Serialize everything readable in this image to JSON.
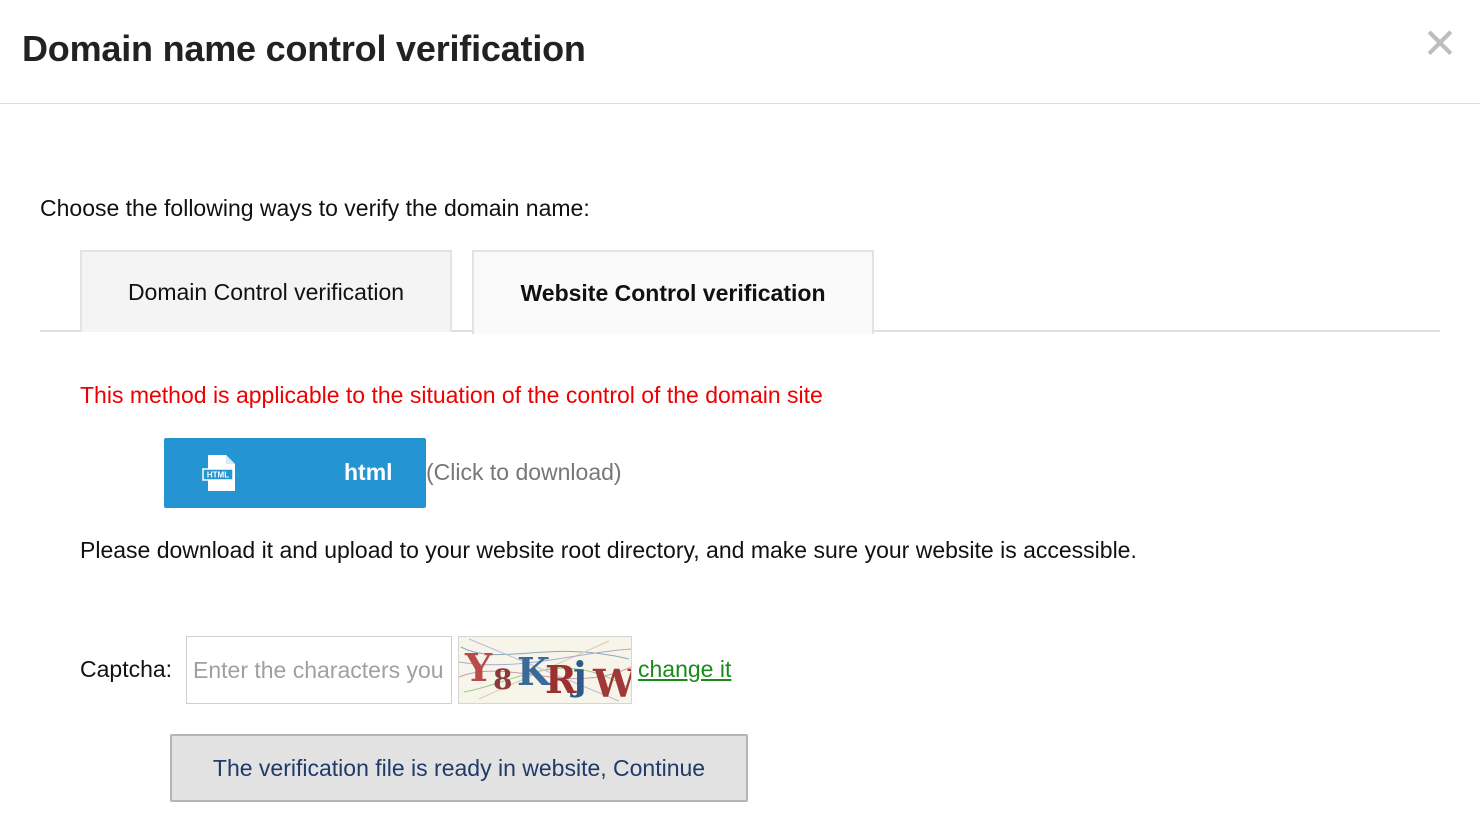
{
  "dialog": {
    "title": "Domain name control verification",
    "close_icon": "close-icon",
    "close_glyph": "✕"
  },
  "instruction": "Choose the following ways to verify the domain name:",
  "tabs": [
    {
      "label": "Domain Control verification",
      "active": false
    },
    {
      "label": "Website Control verification",
      "active": true
    }
  ],
  "method_note": "This method is applicable to the situation of the control of the domain site",
  "download": {
    "icon": "html-file-icon",
    "icon_text": "HTML",
    "label": "html",
    "hint": "(Click to download)",
    "color": "#2594d2"
  },
  "upload_note": "Please download it and upload to your website root directory, and make sure your website is accessible.",
  "captcha": {
    "label": "Captcha:",
    "value": "",
    "placeholder": "Enter the characters you see",
    "image_chars": [
      "Y",
      "8",
      "K",
      "R",
      "j",
      "W"
    ],
    "change_link": "change it"
  },
  "continue_button": "The verification file is ready in website, Continue",
  "colors": {
    "note_red": "#ee0000",
    "link_green": "#1a8a1a",
    "button_text": "#203a6a"
  }
}
